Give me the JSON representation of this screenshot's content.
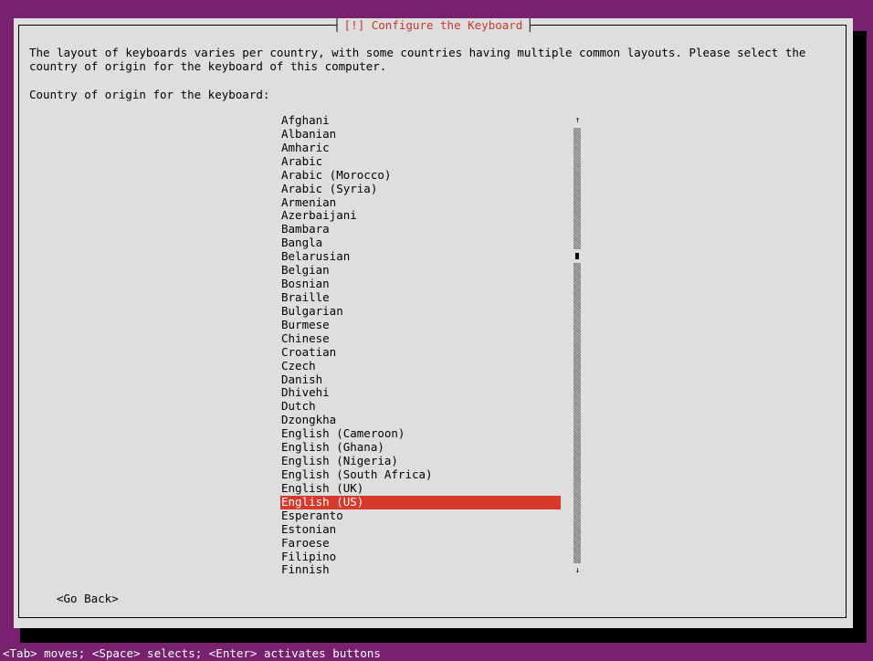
{
  "dialog": {
    "title": "[!] Configure the Keyboard",
    "description": "The layout of keyboards varies per country, with some countries having multiple common layouts. Please select the\ncountry of origin for the keyboard of this computer.",
    "prompt": "Country of origin for the keyboard:",
    "go_back_label": "<Go Back>"
  },
  "list": {
    "items": [
      "Afghani",
      "Albanian",
      "Amharic",
      "Arabic",
      "Arabic (Morocco)",
      "Arabic (Syria)",
      "Armenian",
      "Azerbaijani",
      "Bambara",
      "Bangla",
      "Belarusian",
      "Belgian",
      "Bosnian",
      "Braille",
      "Bulgarian",
      "Burmese",
      "Chinese",
      "Croatian",
      "Czech",
      "Danish",
      "Dhivehi",
      "Dutch",
      "Dzongkha",
      "English (Cameroon)",
      "English (Ghana)",
      "English (Nigeria)",
      "English (South Africa)",
      "English (UK)",
      "English (US)",
      "Esperanto",
      "Estonian",
      "Faroese",
      "Filipino",
      "Finnish"
    ],
    "selected": "English (US)",
    "scroll_up_glyph": "↑",
    "scroll_down_glyph": "↓"
  },
  "status_bar": {
    "text": "<Tab> moves; <Space> selects; <Enter> activates buttons"
  },
  "colors": {
    "background": "#77216f",
    "dialog": "#dedede",
    "accent": "#d8392b",
    "title_text": "#c7372b"
  }
}
